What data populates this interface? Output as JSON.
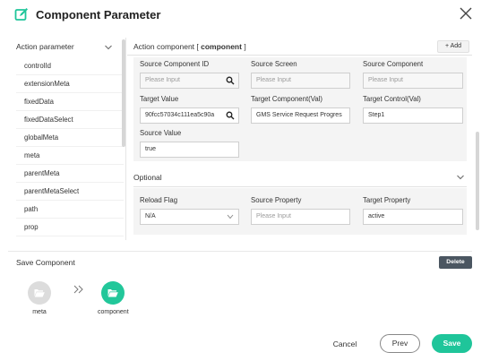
{
  "header": {
    "title": "Component Parameter",
    "edit_icon": "edit-icon",
    "close_icon": "close-icon"
  },
  "left_panel": {
    "title": "Action parameter",
    "items": [
      "controlId",
      "extensionMeta",
      "fixedData",
      "fixedDataSelect",
      "globalMeta",
      "meta",
      "parentMeta",
      "parentMetaSelect",
      "path",
      "prop"
    ]
  },
  "right_panel": {
    "title_prefix": "Action component [",
    "title_bold": "component",
    "title_suffix": "]",
    "add_label": "+ Add",
    "fields": {
      "source_component_id": {
        "label": "Source Component ID",
        "placeholder": "Please Input"
      },
      "source_screen": {
        "label": "Source Screen",
        "placeholder": "Please Input"
      },
      "source_component": {
        "label": "Source Component",
        "placeholder": "Please Input"
      },
      "target_value": {
        "label": "Target Value",
        "value": "90fcc57034c111ea5c90a"
      },
      "target_component_val": {
        "label": "Target Component(Val)",
        "value": "GMS Service Request Progres"
      },
      "target_control_val": {
        "label": "Target Control(Val)",
        "value": "Step1"
      },
      "source_value": {
        "label": "Source Value",
        "value": "true"
      }
    },
    "optional": {
      "label": "Optional",
      "reload_flag": {
        "label": "Reload Flag",
        "value": "N/A"
      },
      "source_property": {
        "label": "Source Property",
        "placeholder": "Please Input"
      },
      "target_property": {
        "label": "Target Property",
        "value": "active"
      }
    }
  },
  "save_component": {
    "title": "Save Component",
    "delete_label": "Delete",
    "nodes": [
      {
        "label": "meta",
        "color": "#dcdcdc",
        "icon": "folder-open-icon"
      },
      {
        "label": "component",
        "color": "#22c79a",
        "icon": "folder-open-icon"
      }
    ]
  },
  "footer": {
    "cancel_label": "Cancel",
    "prev_label": "Prev",
    "save_label": "Save"
  },
  "colors": {
    "accent": "#1fc59a",
    "delete_button": "#4b5661"
  }
}
